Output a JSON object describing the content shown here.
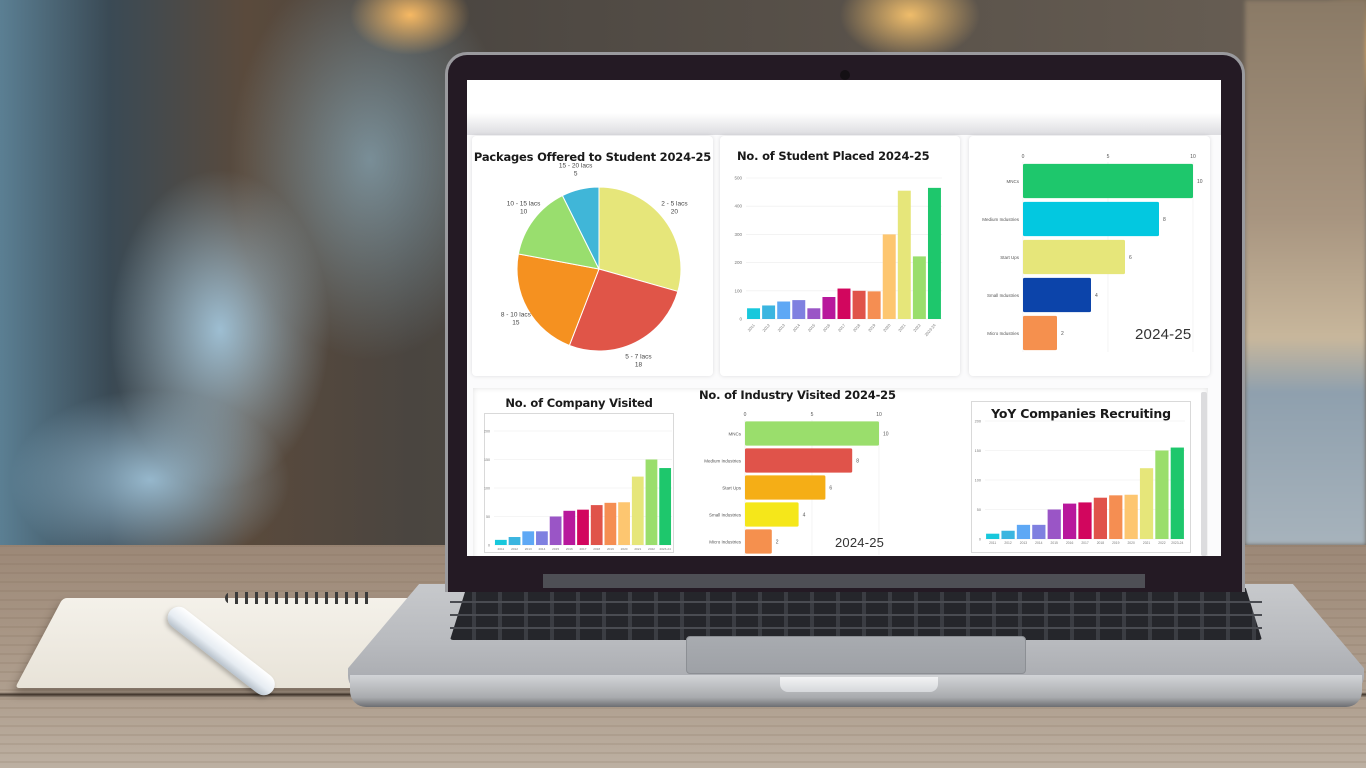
{
  "scene": {
    "description": "Laptop on wooden desk displaying a placement statistics dashboard",
    "colors": {
      "screen_background": "#fbfbfc",
      "bezel": "#241a24",
      "laptop_body": "#b8babe"
    }
  },
  "dashboard": {
    "panels": [
      {
        "title": "Packages Offered to Student 2024-25"
      },
      {
        "title": "No. of Student Placed 2024-25"
      },
      {
        "title": "",
        "year_label": "2024-25"
      },
      {
        "title": "No. of Company Visited"
      },
      {
        "title": "No. of Industry Visited 2024-25",
        "year_label": "2024-25"
      },
      {
        "title": "YoY Companies Recruiting"
      }
    ]
  },
  "chart_data": [
    {
      "id": "packages",
      "type": "pie",
      "title": "Packages Offered to Student 2024-25",
      "slices": [
        {
          "label": "2 - 5 lacs",
          "value": 20,
          "color": "#e6e67a"
        },
        {
          "label": "5 - 7 lacs",
          "value": 18,
          "color": "#e05548"
        },
        {
          "label": "8 - 10 lacs",
          "value": 15,
          "color": "#f59120"
        },
        {
          "label": "10 - 15 lacs",
          "value": 10,
          "color": "#99de6e"
        },
        {
          "label": "15 - 20 lacs",
          "value": 5,
          "color": "#40b6d8"
        }
      ],
      "legend": "none",
      "data_labels": "outside"
    },
    {
      "id": "students_placed",
      "type": "bar",
      "title": "No. of Student Placed 2024-25",
      "categories": [
        "2011",
        "2012",
        "2013",
        "2014",
        "2015",
        "2016",
        "2017",
        "2018",
        "2019",
        "2020",
        "2021",
        "2022",
        "2023-24"
      ],
      "values": [
        38,
        48,
        62,
        67,
        38,
        78,
        108,
        100,
        98,
        300,
        455,
        222,
        465
      ],
      "colors": [
        "#18c8dc",
        "#3bb5e0",
        "#5ea8f5",
        "#7f80e0",
        "#9a55c6",
        "#b8189c",
        "#d2065e",
        "#e0534a",
        "#f58e52",
        "#fdc670",
        "#e6e67a",
        "#9ade6c",
        "#1ec76c"
      ],
      "xlabel": "",
      "ylabel": "",
      "ylim": [
        0,
        500
      ],
      "yticks": [
        "0",
        "100",
        "200",
        "300",
        "400",
        "500"
      ],
      "grid": true
    },
    {
      "id": "industry_types_placed",
      "type": "bar",
      "orientation": "horizontal",
      "title": "",
      "annotation": "2024-25",
      "categories": [
        "MNCs",
        "Medium Industries",
        "Start Ups",
        "Small Industries",
        "Micro Industries"
      ],
      "values": [
        10,
        8,
        6,
        4,
        2
      ],
      "colors": [
        "#1ec76c",
        "#03c8e0",
        "#e6e67a",
        "#0c44aa",
        "#f5904e"
      ],
      "xlim": [
        0,
        10
      ],
      "xticks": [
        "0",
        "5",
        "10"
      ],
      "grid": true
    },
    {
      "id": "company_visited",
      "type": "bar",
      "title": "No. of Company Visited",
      "categories": [
        "2011",
        "2012",
        "2013",
        "2014",
        "2015",
        "2016",
        "2017",
        "2018",
        "2019",
        "2020",
        "2021",
        "2022",
        "2023-24"
      ],
      "values": [
        9,
        14,
        24,
        24,
        50,
        60,
        62,
        70,
        74,
        75,
        120,
        150,
        135
      ],
      "colors": [
        "#18c8dc",
        "#3bb5e0",
        "#5ea8f5",
        "#7f80e0",
        "#9a55c6",
        "#b8189c",
        "#d2065e",
        "#e0534a",
        "#f58e52",
        "#fdc670",
        "#e6e67a",
        "#9ade6c",
        "#1ec76c"
      ],
      "ylim": [
        0,
        200
      ],
      "yticks": [
        "0",
        "50",
        "100",
        "150",
        "200"
      ],
      "grid": true
    },
    {
      "id": "industry_visited",
      "type": "bar",
      "orientation": "horizontal",
      "title": "No. of Industry Visited 2024-25",
      "annotation": "2024-25",
      "categories": [
        "MNCs",
        "Medium Industries",
        "Start Ups",
        "Small Industries",
        "Micro Industries"
      ],
      "values": [
        10,
        8,
        6,
        4,
        2
      ],
      "colors": [
        "#9ade6c",
        "#e0534a",
        "#f5ae16",
        "#f5e71a",
        "#f5904e"
      ],
      "xlim": [
        0,
        10
      ],
      "xticks": [
        "0",
        "5",
        "10"
      ],
      "grid": true
    },
    {
      "id": "yoy_recruiting",
      "type": "bar",
      "title": "YoY Companies Recruiting",
      "categories": [
        "2011",
        "2012",
        "2013",
        "2014",
        "2015",
        "2016",
        "2017",
        "2018",
        "2019",
        "2020",
        "2021",
        "2022",
        "2023-24"
      ],
      "values": [
        9,
        14,
        24,
        24,
        50,
        60,
        62,
        70,
        74,
        75,
        120,
        150,
        155
      ],
      "colors": [
        "#18c8dc",
        "#3bb5e0",
        "#5ea8f5",
        "#7f80e0",
        "#9a55c6",
        "#b8189c",
        "#d2065e",
        "#e0534a",
        "#f58e52",
        "#fdc670",
        "#e6e67a",
        "#9ade6c",
        "#1ec76c"
      ],
      "ylim": [
        0,
        200
      ],
      "yticks": [
        "0",
        "50",
        "100",
        "150",
        "200"
      ],
      "grid": true
    }
  ]
}
